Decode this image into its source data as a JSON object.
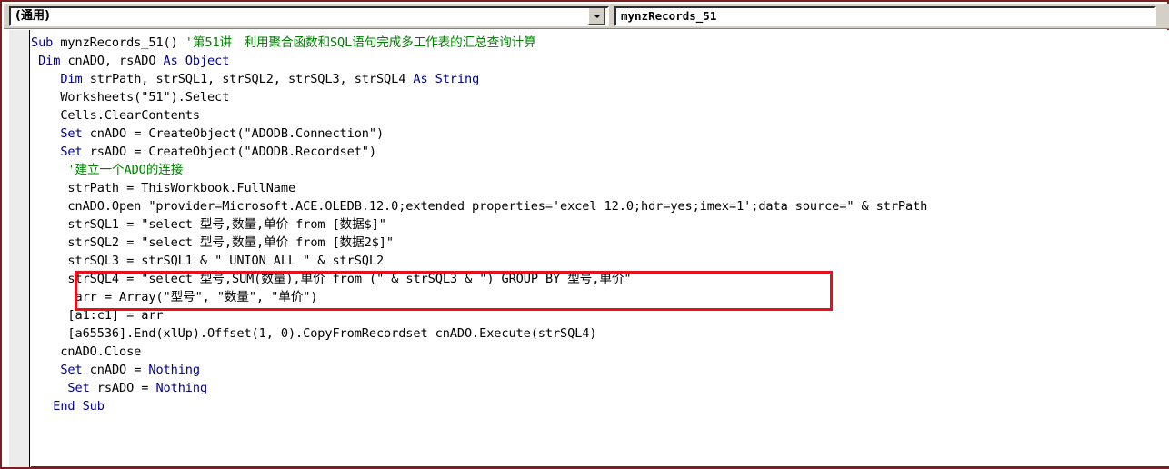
{
  "window": {
    "border_color": "#7a2020",
    "background": "#ffffff"
  },
  "header": {
    "object_combo": {
      "value": "(通用)",
      "arrow_icon": "chevron-down-icon"
    },
    "procedure_combo": {
      "value": "mynzRecords_51",
      "arrow_icon": "chevron-down-icon"
    }
  },
  "editor": {
    "margin_indicator": "",
    "highlight": {
      "color": "#e8101b",
      "covers_lines": [
        13,
        14
      ]
    },
    "lines": [
      {
        "n": 1,
        "segments": [
          {
            "t": "Sub ",
            "c": "kw"
          },
          {
            "t": "mynzRecords_51() ",
            "c": ""
          },
          {
            "t": "'第51讲　利用聚合函数和SQL语句完成多工作表的汇总查询计算",
            "c": "cmt"
          }
        ]
      },
      {
        "n": 2,
        "segments": [
          {
            "t": " ",
            "c": ""
          },
          {
            "t": "Dim ",
            "c": "kw"
          },
          {
            "t": "cnADO, rsADO ",
            "c": ""
          },
          {
            "t": "As Object",
            "c": "kw"
          }
        ]
      },
      {
        "n": 3,
        "segments": [
          {
            "t": "    ",
            "c": ""
          },
          {
            "t": "Dim ",
            "c": "kw"
          },
          {
            "t": "strPath, strSQL1, strSQL2, strSQL3, strSQL4 ",
            "c": ""
          },
          {
            "t": "As String",
            "c": "kw"
          }
        ]
      },
      {
        "n": 4,
        "segments": [
          {
            "t": "    Worksheets(\"51\").Select",
            "c": ""
          }
        ]
      },
      {
        "n": 5,
        "segments": [
          {
            "t": "    Cells.ClearContents",
            "c": ""
          }
        ]
      },
      {
        "n": 6,
        "segments": [
          {
            "t": "    ",
            "c": ""
          },
          {
            "t": "Set ",
            "c": "kw"
          },
          {
            "t": "cnADO = CreateObject(\"ADODB.Connection\")",
            "c": ""
          }
        ]
      },
      {
        "n": 7,
        "segments": [
          {
            "t": "    ",
            "c": ""
          },
          {
            "t": "Set ",
            "c": "kw"
          },
          {
            "t": "rsADO = CreateObject(\"ADODB.Recordset\")",
            "c": ""
          }
        ]
      },
      {
        "n": 8,
        "segments": [
          {
            "t": "     ",
            "c": ""
          },
          {
            "t": "'建立一个ADO的连接",
            "c": "cmt"
          }
        ]
      },
      {
        "n": 9,
        "segments": [
          {
            "t": "     strPath = ThisWorkbook.FullName",
            "c": ""
          }
        ]
      },
      {
        "n": 10,
        "segments": [
          {
            "t": "     cnADO.Open \"provider=Microsoft.ACE.OLEDB.12.0;extended properties='excel 12.0;hdr=yes;imex=1';data source=\" & strPath",
            "c": ""
          }
        ]
      },
      {
        "n": 11,
        "segments": [
          {
            "t": "     strSQL1 = \"select 型号,数量,单价 from [数据$]\"",
            "c": ""
          }
        ]
      },
      {
        "n": 12,
        "segments": [
          {
            "t": "     strSQL2 = \"select 型号,数量,单价 from [数据2$]\"",
            "c": ""
          }
        ]
      },
      {
        "n": 13,
        "segments": [
          {
            "t": "     strSQL3 = strSQL1 & \" UNION ALL \" & strSQL2",
            "c": ""
          }
        ]
      },
      {
        "n": 14,
        "segments": [
          {
            "t": "     strSQL4 = \"select 型号,SUM(数量),单价 from (\" & strSQL3 & \") GROUP BY 型号,单价\"",
            "c": ""
          }
        ]
      },
      {
        "n": 15,
        "segments": [
          {
            "t": "      arr = Array(\"型号\", \"数量\", \"单价\")",
            "c": ""
          }
        ]
      },
      {
        "n": 16,
        "segments": [
          {
            "t": "     [a1:c1] = arr",
            "c": ""
          }
        ]
      },
      {
        "n": 17,
        "segments": [
          {
            "t": "     [a65536].End(xlUp).Offset(1, 0).CopyFromRecordset cnADO.Execute(strSQL4)",
            "c": ""
          }
        ]
      },
      {
        "n": 18,
        "segments": [
          {
            "t": "    cnADO.Close",
            "c": ""
          }
        ]
      },
      {
        "n": 19,
        "segments": [
          {
            "t": "    ",
            "c": ""
          },
          {
            "t": "Set ",
            "c": "kw"
          },
          {
            "t": "cnADO = ",
            "c": ""
          },
          {
            "t": "Nothing",
            "c": "kw"
          }
        ]
      },
      {
        "n": 20,
        "segments": [
          {
            "t": "     ",
            "c": ""
          },
          {
            "t": "Set ",
            "c": "kw"
          },
          {
            "t": "rsADO = ",
            "c": ""
          },
          {
            "t": "Nothing",
            "c": "kw"
          }
        ]
      },
      {
        "n": 21,
        "segments": [
          {
            "t": "   ",
            "c": ""
          },
          {
            "t": "End Sub",
            "c": "kw"
          }
        ]
      }
    ]
  }
}
